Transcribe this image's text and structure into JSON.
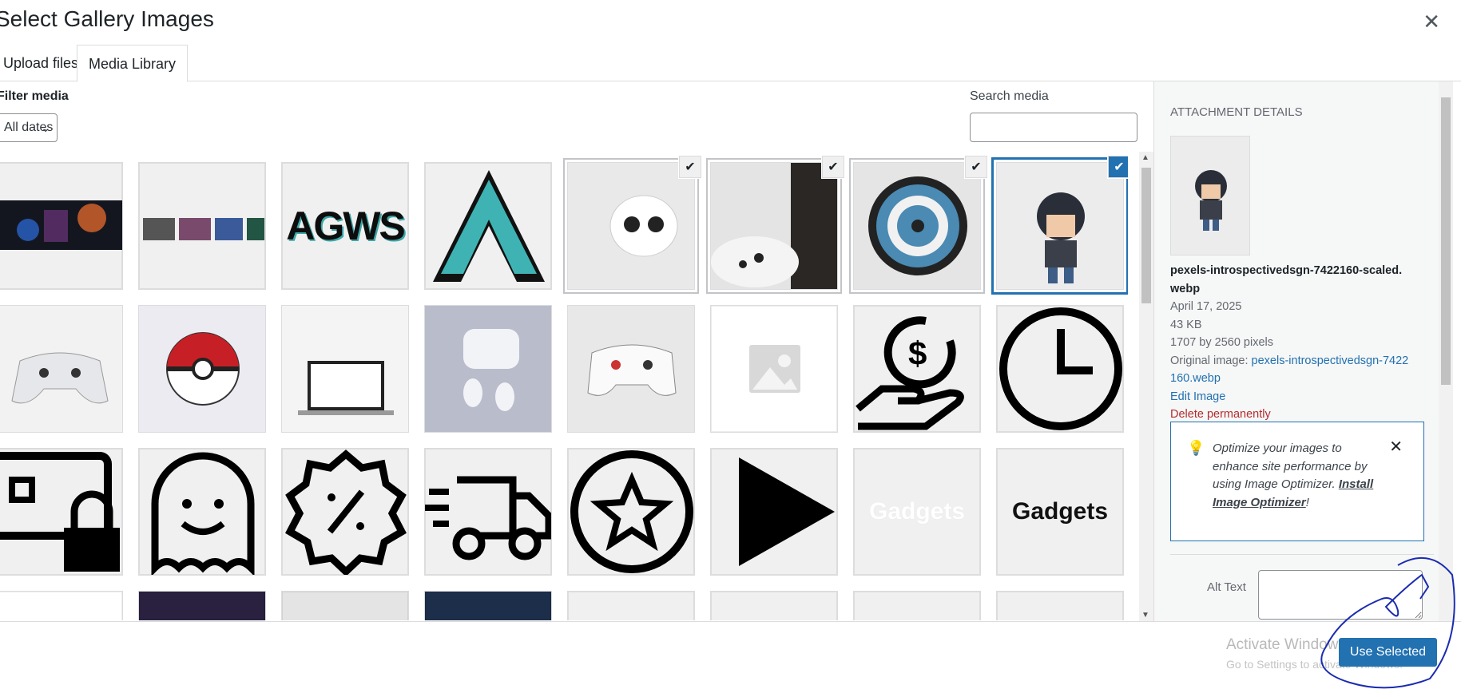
{
  "modal": {
    "title": "Select Gallery Images",
    "close_icon": "close-icon"
  },
  "tabs": [
    {
      "label": "Upload files"
    },
    {
      "label": "Media Library"
    }
  ],
  "filter": {
    "label": "Filter media",
    "value": "All dates"
  },
  "search": {
    "label": "Search media",
    "value": ""
  },
  "grid": {
    "items": [
      {
        "icon": "banner-thumbnail",
        "selected": false
      },
      {
        "icon": "collage-thumbnail",
        "selected": false
      },
      {
        "icon": "agws-logo-thumbnail",
        "text": "AGWS",
        "selected": false
      },
      {
        "icon": "a-logo-thumbnail",
        "selected": false
      },
      {
        "icon": "earbuds-thumbnail",
        "selected": true
      },
      {
        "icon": "controller-thumbnail",
        "selected": true
      },
      {
        "icon": "dartboard-thumbnail",
        "selected": true
      },
      {
        "icon": "figure-thumbnail",
        "selected": true,
        "current": true
      },
      {
        "icon": "gamepad-thumbnail",
        "selected": false
      },
      {
        "icon": "pokeball-thumbnail",
        "selected": false
      },
      {
        "icon": "laptop-thumbnail",
        "selected": false
      },
      {
        "icon": "airpods-thumbnail",
        "selected": false
      },
      {
        "icon": "stadia-controller-thumbnail",
        "selected": false
      },
      {
        "icon": "placeholder-image-icon",
        "selected": false
      },
      {
        "icon": "dollar-hand-icon",
        "selected": false
      },
      {
        "icon": "clock-icon",
        "selected": false
      },
      {
        "icon": "card-lock-icon",
        "selected": false
      },
      {
        "icon": "ghost-icon",
        "selected": false
      },
      {
        "icon": "discount-badge-icon",
        "selected": false
      },
      {
        "icon": "delivery-truck-icon",
        "selected": false
      },
      {
        "icon": "star-circle-icon",
        "selected": false
      },
      {
        "icon": "play-icon",
        "selected": false
      },
      {
        "icon": "gadgets-white-logo",
        "text": "Gadgets",
        "selected": false
      },
      {
        "icon": "gadgets-dark-logo",
        "text": "Gadgets",
        "selected": false
      }
    ]
  },
  "details": {
    "heading": "Attachment Details",
    "filename": "pexels-introspectivedsgn-7422160-scaled.webp",
    "date": "April 17, 2025",
    "size": "43 KB",
    "dimensions": "1707 by 2560 pixels",
    "original_label": "Original image:",
    "original_link": "pexels-introspectivedsgn-7422160.webp",
    "edit_link": "Edit Image",
    "delete_link": "Delete permanently",
    "notice": {
      "text": "Optimize your images to enhance site performance by using Image Optimizer.",
      "link": "Install Image Optimizer",
      "suffix": "!"
    },
    "alt_label": "Alt Text",
    "alt_value": ""
  },
  "footer": {
    "watermark": "Activate Windows",
    "watermark_sub": "Go to Settings to activate Windows.",
    "button": "Use Selected"
  },
  "colors": {
    "accent": "#2271b1",
    "danger": "#b32d2e",
    "ink": "#1d2327"
  }
}
